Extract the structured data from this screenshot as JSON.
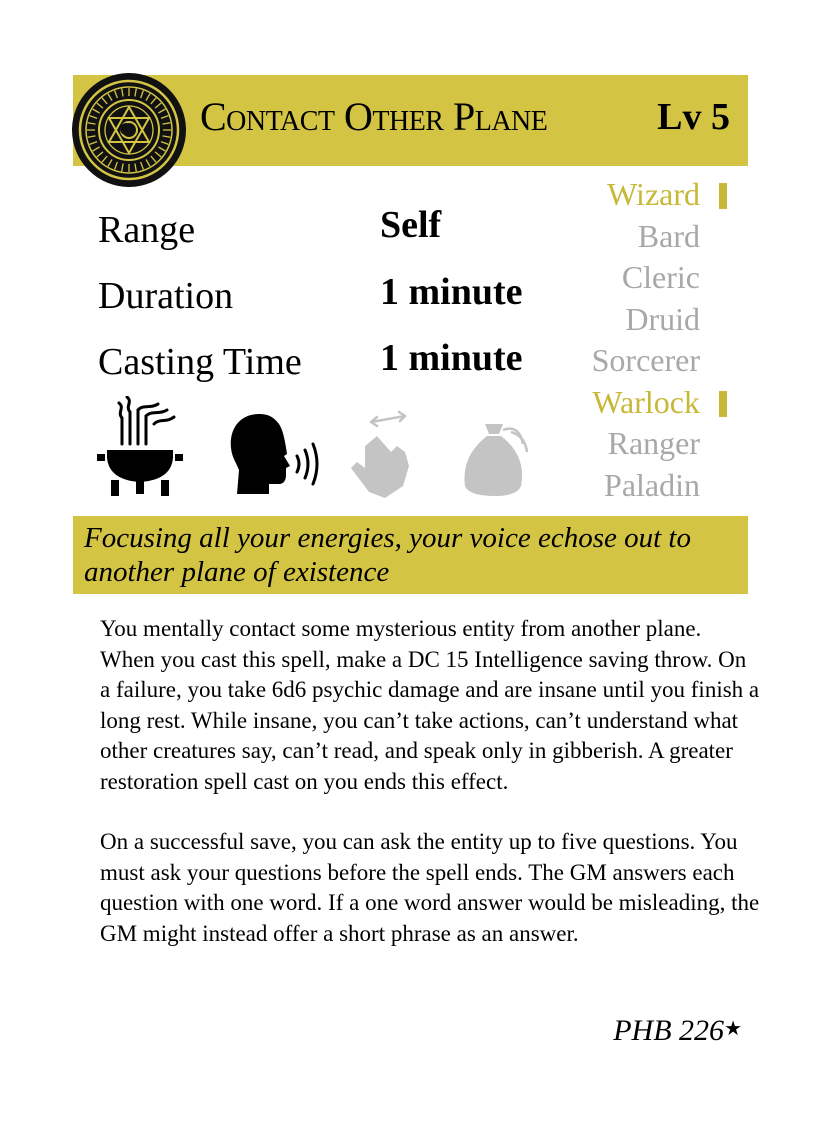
{
  "card": {
    "title": "Contact Other Plane",
    "level": "Lv 5",
    "emblem_icon": "arcane-sigil-icon",
    "accent_color": "#d4c444",
    "inactive_color": "#a8a8a8"
  },
  "stats": [
    {
      "label": "Range",
      "value": "Self"
    },
    {
      "label": "Duration",
      "value": "1 minute"
    },
    {
      "label": "Casting Time",
      "value": "1 minute"
    }
  ],
  "classes": [
    {
      "name": "Wizard",
      "active": true
    },
    {
      "name": "Bard",
      "active": false
    },
    {
      "name": "Cleric",
      "active": false
    },
    {
      "name": "Druid",
      "active": false
    },
    {
      "name": "Sorcerer",
      "active": false
    },
    {
      "name": "Warlock",
      "active": true
    },
    {
      "name": "Ranger",
      "active": false
    },
    {
      "name": "Paladin",
      "active": false
    }
  ],
  "components": [
    {
      "icon": "ritual-brazier-icon",
      "active": true
    },
    {
      "icon": "verbal-speaking-head-icon",
      "active": true
    },
    {
      "icon": "somatic-hand-icon",
      "active": false
    },
    {
      "icon": "material-pouch-icon",
      "active": false
    }
  ],
  "flavor": "Focusing all your energies, your voice echose out to another plane of existence",
  "description": [
    "You mentally contact some mysterious entity from another plane. When you cast this spell, make a DC 15 Intelligence saving throw. On a failure, you take 6d6 psychic damage and are insane until you finish a long rest. While insane, you can’t take actions, can’t understand what other creatures say, can’t read, and speak only in gibberish. A greater restoration spell cast on you ends this effect.",
    "On a successful save, you can ask the entity up to five questions. You must ask your questions before the spell ends. The GM answers each question with one word. If a one word answer would be misleading, the GM might instead offer a short phrase as an answer."
  ],
  "source": {
    "text": "PHB 226",
    "mark": "★"
  }
}
